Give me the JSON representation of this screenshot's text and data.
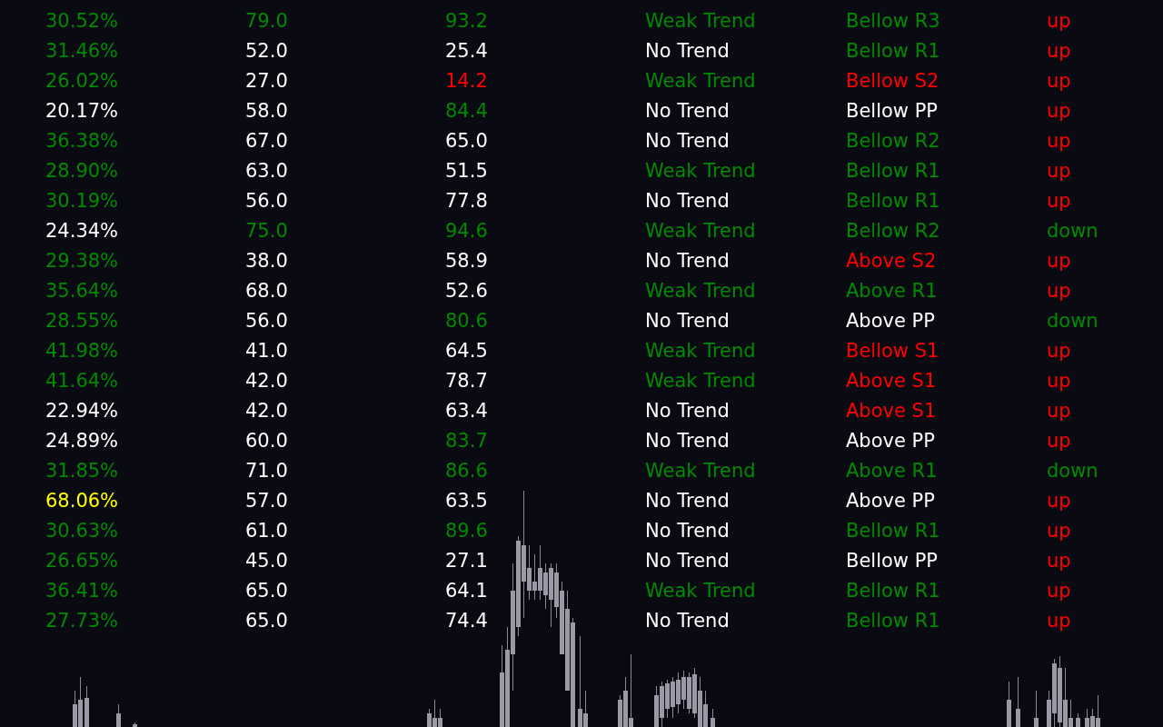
{
  "table": {
    "rows": [
      {
        "cells": [
          {
            "text": "30.52%",
            "color": "#008a00"
          },
          {
            "text": "79.0",
            "color": "#008a00"
          },
          {
            "text": "93.2",
            "color": "#008a00"
          },
          {
            "text": "Weak Trend",
            "color": "#008a00"
          },
          {
            "text": "Bellow R3",
            "color": "#008a00"
          },
          {
            "text": "up",
            "color": "#ff0000"
          }
        ]
      },
      {
        "cells": [
          {
            "text": "31.46%",
            "color": "#008a00"
          },
          {
            "text": "52.0",
            "color": "#ffffff"
          },
          {
            "text": "25.4",
            "color": "#ffffff"
          },
          {
            "text": "No Trend",
            "color": "#ffffff"
          },
          {
            "text": "Bellow R1",
            "color": "#008a00"
          },
          {
            "text": "up",
            "color": "#ff0000"
          }
        ]
      },
      {
        "cells": [
          {
            "text": "26.02%",
            "color": "#008a00"
          },
          {
            "text": "27.0",
            "color": "#ffffff"
          },
          {
            "text": "14.2",
            "color": "#ff0000"
          },
          {
            "text": "Weak Trend",
            "color": "#008a00"
          },
          {
            "text": "Bellow S2",
            "color": "#ff0000"
          },
          {
            "text": "up",
            "color": "#ff0000"
          }
        ]
      },
      {
        "cells": [
          {
            "text": "20.17%",
            "color": "#ffffff"
          },
          {
            "text": "58.0",
            "color": "#ffffff"
          },
          {
            "text": "84.4",
            "color": "#008a00"
          },
          {
            "text": "No Trend",
            "color": "#ffffff"
          },
          {
            "text": "Bellow PP",
            "color": "#ffffff"
          },
          {
            "text": "up",
            "color": "#ff0000"
          }
        ]
      },
      {
        "cells": [
          {
            "text": "36.38%",
            "color": "#008a00"
          },
          {
            "text": "67.0",
            "color": "#ffffff"
          },
          {
            "text": "65.0",
            "color": "#ffffff"
          },
          {
            "text": "No Trend",
            "color": "#ffffff"
          },
          {
            "text": "Bellow R2",
            "color": "#008a00"
          },
          {
            "text": "up",
            "color": "#ff0000"
          }
        ]
      },
      {
        "cells": [
          {
            "text": "28.90%",
            "color": "#008a00"
          },
          {
            "text": "63.0",
            "color": "#ffffff"
          },
          {
            "text": "51.5",
            "color": "#ffffff"
          },
          {
            "text": "Weak Trend",
            "color": "#008a00"
          },
          {
            "text": "Bellow R1",
            "color": "#008a00"
          },
          {
            "text": "up",
            "color": "#ff0000"
          }
        ]
      },
      {
        "cells": [
          {
            "text": "30.19%",
            "color": "#008a00"
          },
          {
            "text": "56.0",
            "color": "#ffffff"
          },
          {
            "text": "77.8",
            "color": "#ffffff"
          },
          {
            "text": "No Trend",
            "color": "#ffffff"
          },
          {
            "text": "Bellow R1",
            "color": "#008a00"
          },
          {
            "text": "up",
            "color": "#ff0000"
          }
        ]
      },
      {
        "cells": [
          {
            "text": "24.34%",
            "color": "#ffffff"
          },
          {
            "text": "75.0",
            "color": "#008a00"
          },
          {
            "text": "94.6",
            "color": "#008a00"
          },
          {
            "text": "Weak Trend",
            "color": "#008a00"
          },
          {
            "text": "Bellow R2",
            "color": "#008a00"
          },
          {
            "text": "down",
            "color": "#008a00"
          }
        ]
      },
      {
        "cells": [
          {
            "text": "29.38%",
            "color": "#008a00"
          },
          {
            "text": "38.0",
            "color": "#ffffff"
          },
          {
            "text": "58.9",
            "color": "#ffffff"
          },
          {
            "text": "No Trend",
            "color": "#ffffff"
          },
          {
            "text": "Above S2",
            "color": "#ff0000"
          },
          {
            "text": "up",
            "color": "#ff0000"
          }
        ]
      },
      {
        "cells": [
          {
            "text": "35.64%",
            "color": "#008a00"
          },
          {
            "text": "68.0",
            "color": "#ffffff"
          },
          {
            "text": "52.6",
            "color": "#ffffff"
          },
          {
            "text": "Weak Trend",
            "color": "#008a00"
          },
          {
            "text": "Above R1",
            "color": "#008a00"
          },
          {
            "text": "up",
            "color": "#ff0000"
          }
        ]
      },
      {
        "cells": [
          {
            "text": "28.55%",
            "color": "#008a00"
          },
          {
            "text": "56.0",
            "color": "#ffffff"
          },
          {
            "text": "80.6",
            "color": "#008a00"
          },
          {
            "text": "No Trend",
            "color": "#ffffff"
          },
          {
            "text": "Above PP",
            "color": "#ffffff"
          },
          {
            "text": "down",
            "color": "#008a00"
          }
        ]
      },
      {
        "cells": [
          {
            "text": "41.98%",
            "color": "#008a00"
          },
          {
            "text": "41.0",
            "color": "#ffffff"
          },
          {
            "text": "64.5",
            "color": "#ffffff"
          },
          {
            "text": "Weak Trend",
            "color": "#008a00"
          },
          {
            "text": "Bellow S1",
            "color": "#ff0000"
          },
          {
            "text": "up",
            "color": "#ff0000"
          }
        ]
      },
      {
        "cells": [
          {
            "text": "41.64%",
            "color": "#008a00"
          },
          {
            "text": "42.0",
            "color": "#ffffff"
          },
          {
            "text": "78.7",
            "color": "#ffffff"
          },
          {
            "text": "Weak Trend",
            "color": "#008a00"
          },
          {
            "text": "Above S1",
            "color": "#ff0000"
          },
          {
            "text": "up",
            "color": "#ff0000"
          }
        ]
      },
      {
        "cells": [
          {
            "text": "22.94%",
            "color": "#ffffff"
          },
          {
            "text": "42.0",
            "color": "#ffffff"
          },
          {
            "text": "63.4",
            "color": "#ffffff"
          },
          {
            "text": "No Trend",
            "color": "#ffffff"
          },
          {
            "text": "Above S1",
            "color": "#ff0000"
          },
          {
            "text": "up",
            "color": "#ff0000"
          }
        ]
      },
      {
        "cells": [
          {
            "text": "24.89%",
            "color": "#ffffff"
          },
          {
            "text": "60.0",
            "color": "#ffffff"
          },
          {
            "text": "83.7",
            "color": "#008a00"
          },
          {
            "text": "No Trend",
            "color": "#ffffff"
          },
          {
            "text": "Above PP",
            "color": "#ffffff"
          },
          {
            "text": "up",
            "color": "#ff0000"
          }
        ]
      },
      {
        "cells": [
          {
            "text": "31.85%",
            "color": "#008a00"
          },
          {
            "text": "71.0",
            "color": "#ffffff"
          },
          {
            "text": "86.6",
            "color": "#008a00"
          },
          {
            "text": "Weak Trend",
            "color": "#008a00"
          },
          {
            "text": "Above R1",
            "color": "#008a00"
          },
          {
            "text": "down",
            "color": "#008a00"
          }
        ]
      },
      {
        "cells": [
          {
            "text": "68.06%",
            "color": "#ffff00"
          },
          {
            "text": "57.0",
            "color": "#ffffff"
          },
          {
            "text": "63.5",
            "color": "#ffffff"
          },
          {
            "text": "No Trend",
            "color": "#ffffff"
          },
          {
            "text": "Above PP",
            "color": "#ffffff"
          },
          {
            "text": "up",
            "color": "#ff0000"
          }
        ]
      },
      {
        "cells": [
          {
            "text": "30.63%",
            "color": "#008a00"
          },
          {
            "text": "61.0",
            "color": "#ffffff"
          },
          {
            "text": "89.6",
            "color": "#008a00"
          },
          {
            "text": "No Trend",
            "color": "#ffffff"
          },
          {
            "text": "Bellow R1",
            "color": "#008a00"
          },
          {
            "text": "up",
            "color": "#ff0000"
          }
        ]
      },
      {
        "cells": [
          {
            "text": "26.65%",
            "color": "#008a00"
          },
          {
            "text": "45.0",
            "color": "#ffffff"
          },
          {
            "text": "27.1",
            "color": "#ffffff"
          },
          {
            "text": "No Trend",
            "color": "#ffffff"
          },
          {
            "text": "Bellow PP",
            "color": "#ffffff"
          },
          {
            "text": "up",
            "color": "#ff0000"
          }
        ]
      },
      {
        "cells": [
          {
            "text": "36.41%",
            "color": "#008a00"
          },
          {
            "text": "65.0",
            "color": "#ffffff"
          },
          {
            "text": "64.1",
            "color": "#ffffff"
          },
          {
            "text": "Weak Trend",
            "color": "#008a00"
          },
          {
            "text": "Bellow R1",
            "color": "#008a00"
          },
          {
            "text": "up",
            "color": "#ff0000"
          }
        ]
      },
      {
        "cells": [
          {
            "text": "27.73%",
            "color": "#008a00"
          },
          {
            "text": "65.0",
            "color": "#ffffff"
          },
          {
            "text": "74.4",
            "color": "#ffffff"
          },
          {
            "text": "No Trend",
            "color": "#ffffff"
          },
          {
            "text": "Bellow R1",
            "color": "#008a00"
          },
          {
            "text": "up",
            "color": "#ff0000"
          }
        ]
      }
    ]
  }
}
